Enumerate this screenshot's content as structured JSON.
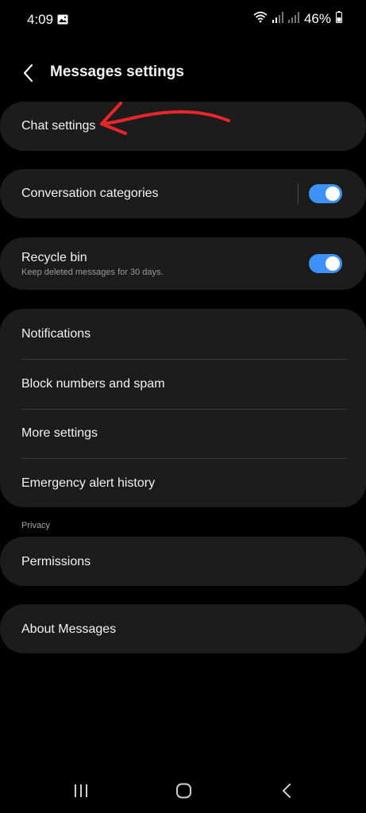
{
  "status_bar": {
    "time": "4:09",
    "battery": "46%",
    "icons": [
      "gallery-icon",
      "wifi-icon",
      "signal-icon",
      "signal-icon",
      "battery-icon"
    ]
  },
  "header": {
    "title": "Messages settings",
    "back_icon": "chevron-left-icon"
  },
  "settings": {
    "chat_settings": "Chat settings",
    "conversation_categories": "Conversation categories",
    "conversation_categories_enabled": true,
    "recycle_bin": "Recycle bin",
    "recycle_bin_sub": "Keep deleted messages for 30 days.",
    "recycle_bin_enabled": true,
    "notifications": "Notifications",
    "block_numbers": "Block numbers and spam",
    "more_settings": "More settings",
    "emergency_alert": "Emergency alert history",
    "privacy_section": "Privacy",
    "permissions": "Permissions",
    "about": "About Messages"
  },
  "annotation": {
    "arrow_color": "#e8262b",
    "points_to": "Chat settings"
  },
  "colors": {
    "toggle_on": "#3e91f6",
    "card_bg": "#1c1c1c",
    "page_bg": "#000000"
  },
  "nav_bar": {
    "icons": [
      "recent-apps-icon",
      "home-icon",
      "back-icon"
    ]
  }
}
